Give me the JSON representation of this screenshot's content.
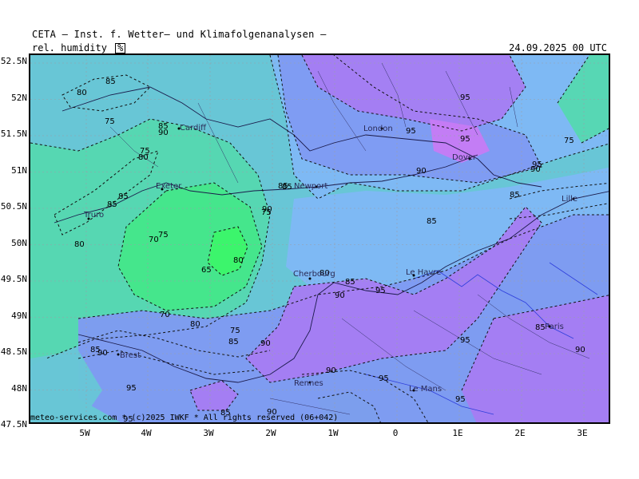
{
  "header": {
    "title": "CETA — Inst. f. Wetter— und Klimafolgenanalysen —",
    "variable": "rel. humidity",
    "unit": "%",
    "valid_time": "24.09.2025 00 UTC"
  },
  "axes": {
    "lat_ticks": [
      "52.5N",
      "52N",
      "51.5N",
      "51N",
      "50.5N",
      "50N",
      "49.5N",
      "49N",
      "48.5N",
      "48N",
      "47.5N"
    ],
    "lon_ticks": [
      "5W",
      "4W",
      "3W",
      "2W",
      "1W",
      "0",
      "1E",
      "2E",
      "3E"
    ]
  },
  "copyright": "meteo-services.com * (c)2025 IWKF * All rights reserved (06+042)",
  "cities": [
    "Cardiff",
    "Exeter",
    "Truro",
    "Newport",
    "London",
    "Dover",
    "Lille",
    "Cherbourg",
    "Le Havre",
    "Brest",
    "Rennes",
    "Le Mans",
    "Paris"
  ],
  "contour_labels": [
    "85",
    "80",
    "75",
    "85",
    "90",
    "75",
    "80",
    "85",
    "85",
    "80",
    "70",
    "75",
    "80",
    "65",
    "70",
    "80",
    "75",
    "85",
    "90",
    "85",
    "90",
    "95",
    "90",
    "95",
    "90",
    "75",
    "90",
    "85",
    "85",
    "80",
    "85",
    "90",
    "95",
    "85",
    "95",
    "95",
    "95",
    "95",
    "85",
    "90",
    "85",
    "90",
    "95",
    "75",
    "90",
    "85",
    "95",
    "95"
  ],
  "colors": {
    "rh_65": "#3cf56a",
    "rh_70": "#45e78a",
    "rh_75": "#55d8b0",
    "rh_80": "#68c6d6",
    "rh_85": "#7fb8f6",
    "rh_90": "#7f9af2",
    "rh_95": "#a77cf2",
    "rh_100": "#c77bf4"
  }
}
